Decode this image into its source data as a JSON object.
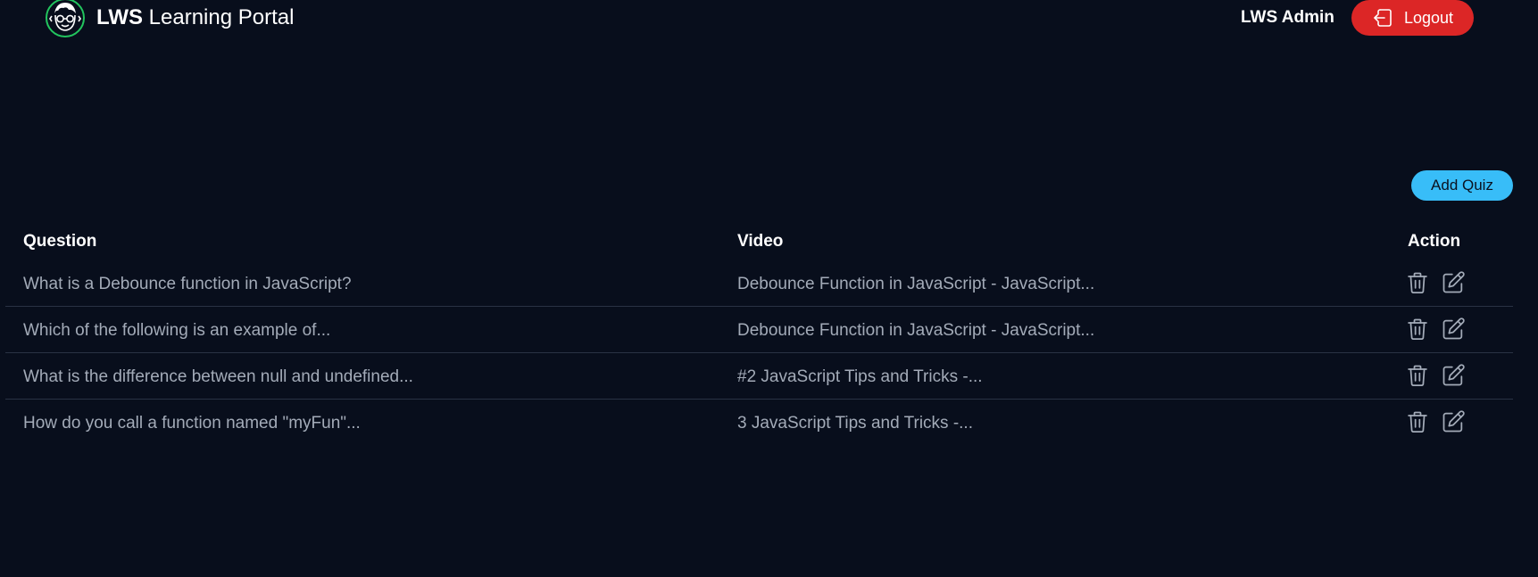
{
  "header": {
    "brand_bold": "LWS",
    "brand_rest": " Learning Portal",
    "logo_icon": "avatar-glasses-icon",
    "admin_name": "LWS Admin",
    "logout_label": "Logout",
    "logout_icon": "logout-icon"
  },
  "toolbar": {
    "add_quiz_label": "Add Quiz"
  },
  "table": {
    "columns": {
      "question": "Question",
      "video": "Video",
      "action": "Action"
    },
    "rows": [
      {
        "question": "What is a Debounce function in JavaScript?",
        "video": "Debounce Function in JavaScript - JavaScript..."
      },
      {
        "question": "Which of the following is an example of...",
        "video": "Debounce Function in JavaScript - JavaScript..."
      },
      {
        "question": "What is the difference between null and undefined...",
        "video": "#2 JavaScript Tips and Tricks -..."
      },
      {
        "question": "How do you call a function named \"myFun\"...",
        "video": "3 JavaScript Tips and Tricks -..."
      }
    ],
    "row_actions": [
      "trash-icon",
      "edit-icon"
    ]
  },
  "colors": {
    "background": "#080e1c",
    "logout": "#dc2626",
    "add_quiz": "#38bdf8",
    "logo_ring": "#22c55e",
    "cell_text": "#a3abb8",
    "divider": "#293244"
  }
}
